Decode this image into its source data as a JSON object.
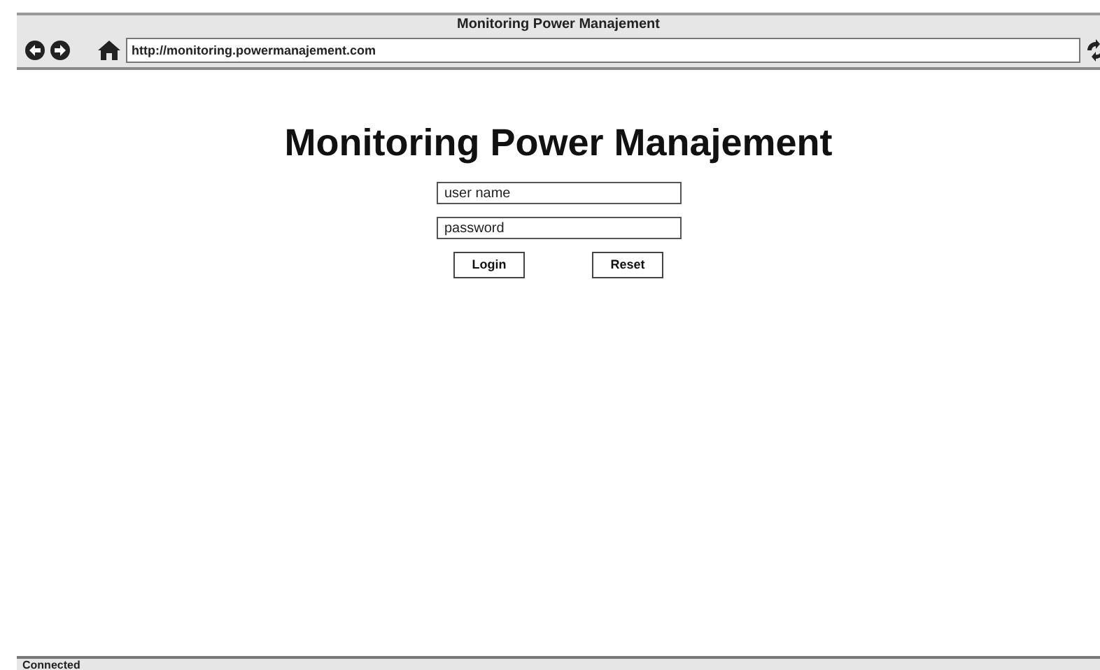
{
  "window": {
    "title": "Monitoring Power Manajement"
  },
  "toolbar": {
    "address": "http://monitoring.powermanajement.com"
  },
  "page": {
    "heading": "Monitoring Power Manajement",
    "fields": [
      {
        "placeholder": "user name"
      },
      {
        "placeholder": "password"
      }
    ],
    "buttons": [
      "Login",
      "Reset"
    ]
  },
  "status_bar": {
    "text": "Connected"
  }
}
